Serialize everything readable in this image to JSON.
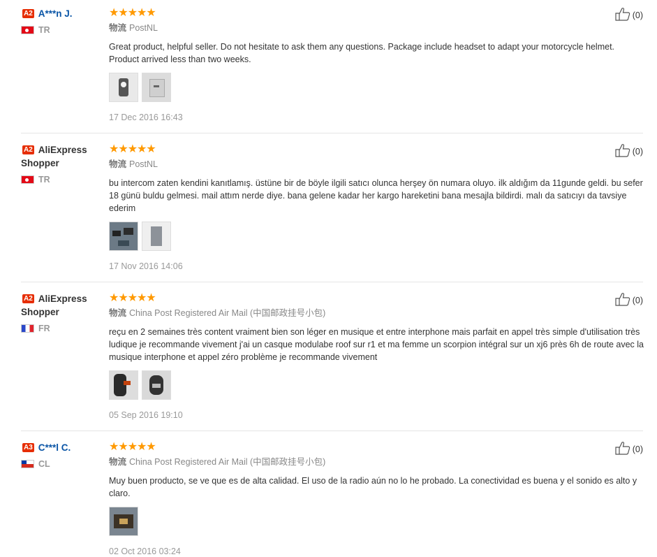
{
  "reviews": [
    {
      "badge": "A2",
      "name": "A***n J.",
      "country": "TR",
      "flag": "flag-tr",
      "stars": "★★★★★",
      "logistics_label": "物流",
      "logistics": "PostNL",
      "text": "Great product, helpful seller. Do not hesitate to ask them any questions. Package include headset to adapt your motorcycle helmet. Product arrived less than two weeks.",
      "date": "17 Dec 2016 16:43",
      "helpful": "(0)"
    },
    {
      "badge": "A2",
      "name": "AliExpress Shopper",
      "country": "TR",
      "flag": "flag-tr",
      "stars": "★★★★★",
      "logistics_label": "物流",
      "logistics": "PostNL",
      "text": "bu intercom zaten kendini kanıtlamış. üstüne bir de böyle ilgili satıcı olunca herşey ön numara oluyo. ilk aldığım da 11gunde geldi. bu sefer 18 günü buldu gelmesi. mail attım nerde diye. bana gelene kadar her kargo hareketini bana mesajla bildirdi. malı da satıcıyı da tavsiye ederim",
      "date": "17 Nov 2016 14:06",
      "helpful": "(0)"
    },
    {
      "badge": "A2",
      "name": "AliExpress Shopper",
      "country": "FR",
      "flag": "flag-fr",
      "stars": "★★★★★",
      "logistics_label": "物流",
      "logistics": "China Post Registered Air Mail (中国邮政挂号小包)",
      "text": "reçu en 2 semaines très content vraiment bien son léger en musique et entre interphone mais parfait en appel très simple d'utilisation très ludique je recommande vivement j'ai un casque modulabe roof sur r1 et ma femme un scorpion intégral sur un xj6 près 6h de route avec la musique interphone et appel zéro problème je recommande vivement",
      "date": "05 Sep 2016 19:10",
      "helpful": "(0)"
    },
    {
      "badge": "A3",
      "name": "C***l C.",
      "country": "CL",
      "flag": "flag-cl",
      "stars": "★★★★★",
      "logistics_label": "物流",
      "logistics": "China Post Registered Air Mail (中国邮政挂号小包)",
      "text": "Muy buen producto, se ve que es de alta calidad. El uso de la radio aún no lo he probado. La conectividad es buena y el sonido es alto y claro.",
      "date": "02 Oct 2016 03:24",
      "helpful": "(0)"
    }
  ],
  "colors": {
    "star": "#ff9900",
    "badge": "#e62e04",
    "link": "#0a55a6"
  },
  "icons": {
    "helpful": "thumbs-up-icon"
  }
}
